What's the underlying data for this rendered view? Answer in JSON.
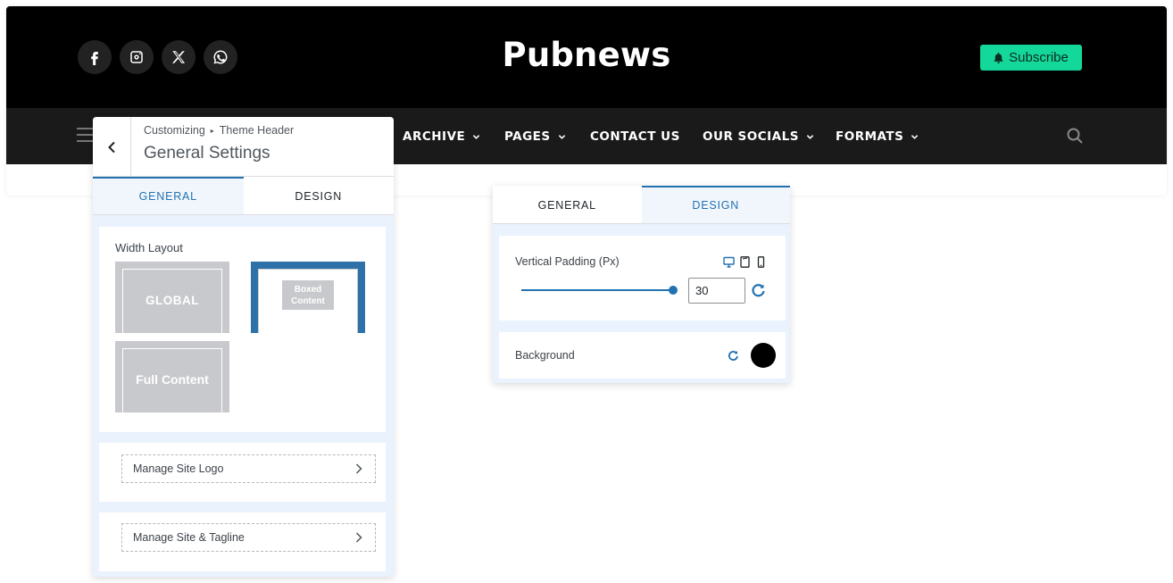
{
  "header": {
    "site_title": "Pubnews",
    "subscribe_label": "Subscribe",
    "social_icons": [
      "facebook-icon",
      "instagram-icon",
      "x-icon",
      "whatsapp-icon"
    ],
    "nav": [
      {
        "label": "ARCHIVE",
        "dropdown": true
      },
      {
        "label": "PAGES",
        "dropdown": true
      },
      {
        "label": "CONTACT US",
        "dropdown": false
      },
      {
        "label": "OUR SOCIALS",
        "dropdown": true
      },
      {
        "label": "FORMATS",
        "dropdown": true
      }
    ]
  },
  "left_panel": {
    "breadcrumb": [
      "Customizing",
      "Theme Header"
    ],
    "title": "General Settings",
    "tabs": {
      "general": "GENERAL",
      "design": "DESIGN",
      "active": "general"
    },
    "width_layout": {
      "label": "Width Layout",
      "options": [
        "GLOBAL",
        "Boxed Content",
        "Full Content"
      ],
      "selected": "Boxed Content"
    },
    "manage_logo": "Manage Site Logo",
    "manage_tagline": "Manage Site & Tagline"
  },
  "right_panel": {
    "tabs": {
      "general": "GENERAL",
      "design": "DESIGN",
      "active": "design"
    },
    "vertical_padding": {
      "label": "Vertical Padding (Px)",
      "value": "30",
      "slider_fraction": 0.86
    },
    "background": {
      "label": "Background",
      "color": "#000000"
    }
  },
  "colors": {
    "accent": "#2271b1",
    "subscribe_bg": "#14d89a",
    "header_bg": "#000000",
    "nav_bg": "#1a1a1a"
  }
}
